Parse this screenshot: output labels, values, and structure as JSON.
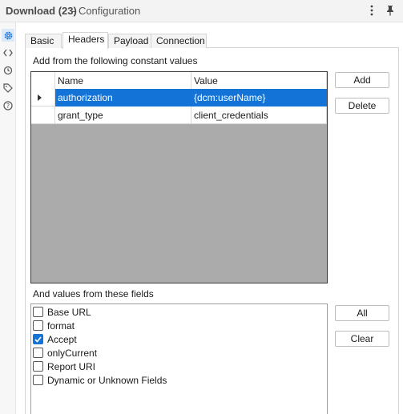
{
  "titlebar": {
    "tool_name": "Download (23)",
    "section": "- Configuration"
  },
  "rail": {
    "icons": [
      "gear-icon",
      "code-icon",
      "target-icon",
      "tag-icon",
      "help-icon"
    ]
  },
  "tabs": [
    {
      "label": "Basic",
      "active": false
    },
    {
      "label": "Headers",
      "active": true
    },
    {
      "label": "Payload",
      "active": false
    },
    {
      "label": "Connection",
      "active": false
    }
  ],
  "headers": {
    "constant_label": "Add from the following constant values",
    "columns": [
      "Name",
      "Value"
    ],
    "rows": [
      {
        "name": "authorization",
        "value": "{dcm:userName}",
        "selected": true
      },
      {
        "name": "grant_type",
        "value": "client_credentials",
        "selected": false
      }
    ],
    "add_label": "Add",
    "delete_label": "Delete"
  },
  "fields": {
    "label": "And values from these fields",
    "items": [
      {
        "label": "Base URL",
        "checked": false
      },
      {
        "label": "format",
        "checked": false
      },
      {
        "label": "Accept",
        "checked": true
      },
      {
        "label": "onlyCurrent",
        "checked": false
      },
      {
        "label": "Report URI",
        "checked": false
      },
      {
        "label": "Dynamic or Unknown Fields",
        "checked": false
      }
    ],
    "all_label": "All",
    "clear_label": "Clear"
  },
  "colors": {
    "accent": "#1473d6",
    "grid_empty": "#ababab"
  }
}
